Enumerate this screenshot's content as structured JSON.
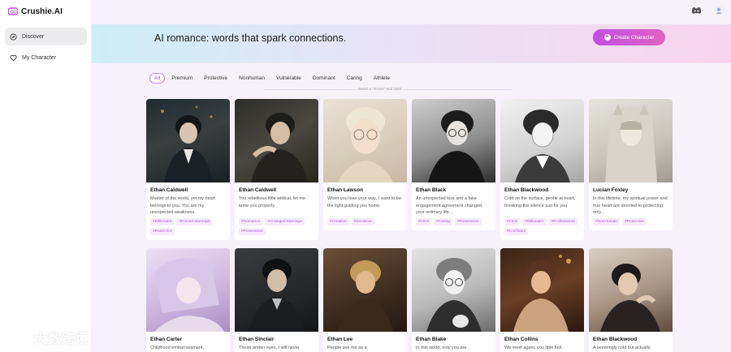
{
  "app": {
    "name": "Crushie.AI"
  },
  "sidebar": {
    "items": [
      {
        "label": "Discover",
        "active": true,
        "icon": "compass-icon"
      },
      {
        "label": "My Character",
        "active": false,
        "icon": "heart-icon"
      }
    ]
  },
  "header": {
    "icons": [
      "discord-icon",
      "user-avatar-icon"
    ]
  },
  "banner": {
    "title": "AI romance: words that spark connections.",
    "create_label": "Create Character"
  },
  "filters": [
    "All",
    "Premium",
    "Protective",
    "Nonhuman",
    "Vulnerable",
    "Dominant",
    "Caring",
    "Athlete"
  ],
  "hint": "Select a \"Scene\" and start!",
  "cards": [
    {
      "name": "Ethan Caldwell",
      "desc": "Master of the world, yet my heart belongs to you. You are my unexpected weakness.",
      "tags": [
        "#Billionaire",
        "#Forced Marriage",
        "#Protective"
      ]
    },
    {
      "name": "Ethan Caldwell",
      "desc": "You rebellious little wildcat, let me tame you properly.",
      "tags": [
        "#Romance",
        "#Arranged Marriage",
        "#Possessive"
      ]
    },
    {
      "name": "Ethan Lawson",
      "desc": "When you lose your way, I want to be the light guiding you home.",
      "tags": [
        "#Creative",
        "#Sensitive"
      ]
    },
    {
      "name": "Ethan Black",
      "desc": "An unexpected kiss and a fake engagement agreement changed your ordinary life...",
      "tags": [
        "#CEO",
        "#Caring",
        "#Possessive"
      ]
    },
    {
      "name": "Ethan Blackwood",
      "desc": "Cold on the surface, gentle at heart, breaking the silence just for you",
      "tags": [
        "#CEO",
        "#Billionaire",
        "#Professional",
        "#Confidant"
      ]
    },
    {
      "name": "Lucian Foxley",
      "desc": "In this lifetime, my spiritual power and true heart are devoted to protecting only...",
      "tags": [
        "#NonHuman",
        "#Protective"
      ]
    },
    {
      "name": "Ethan Carter",
      "desc": "Childhood embarrassment,",
      "tags": []
    },
    {
      "name": "Ethan Sinclair",
      "desc": "Those amber eyes, I will never",
      "tags": []
    },
    {
      "name": "Ethan Lee",
      "desc": "People see me as a",
      "tags": []
    },
    {
      "name": "Ethan Blake",
      "desc": "In this world, only you are",
      "tags": []
    },
    {
      "name": "Ethan Collins",
      "desc": "We meet again, you little fool.",
      "tags": []
    },
    {
      "name": "Ethan Blackwood",
      "desc": "A seemingly cold but actually",
      "tags": []
    }
  ],
  "watermark": "大数跨境",
  "colors": {
    "accent": "#c04fe0",
    "tag_text": "#b15fd6",
    "tag_bg": "#f7ecfb"
  }
}
